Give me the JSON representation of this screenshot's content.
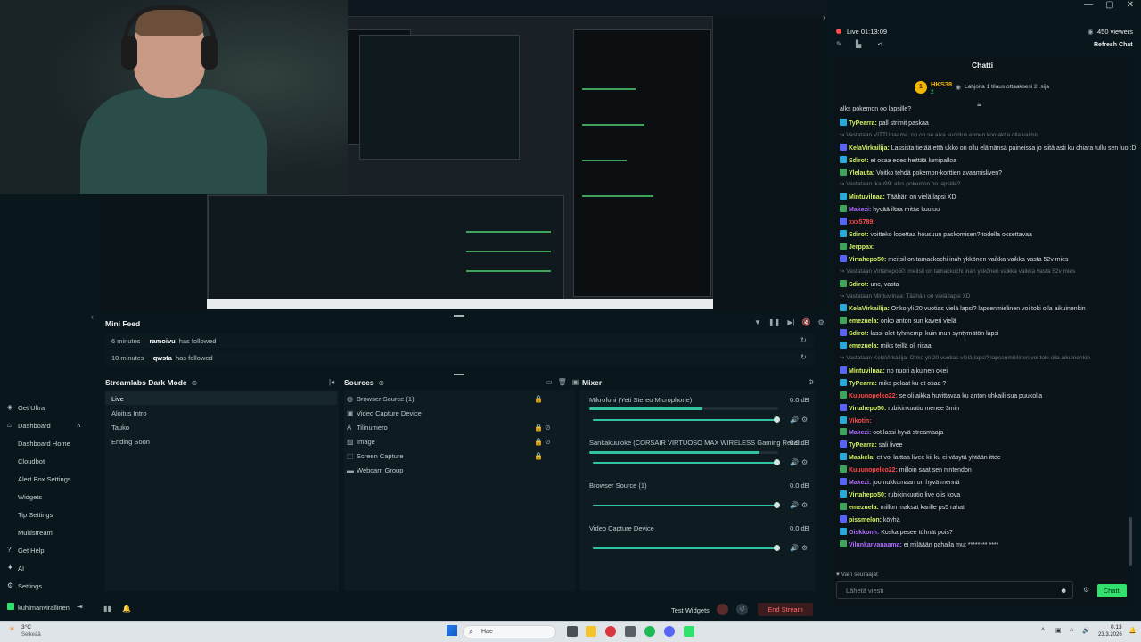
{
  "chat": {
    "live_label": "Live 01:13:09",
    "viewers": "450 viewers",
    "refresh_label": "Refresh Chat",
    "title": "Chatti",
    "sub_user": "HKS38",
    "sub_count": "2",
    "sub_text": "Lahjoita 1 tilaus ottaaksesi 2. sija",
    "messages": [
      {
        "user": "",
        "text": "alks pokemon oo lapsille?",
        "faint": false,
        "color": "#d9dfe0"
      },
      {
        "user": "TyPearra:",
        "text": "pall strimit paskaa",
        "faint": false,
        "color": "#d5f062"
      },
      {
        "user": "",
        "text": "Vastataan VITTUnaama: no on se aika suoritus ennen kontaktia olla valmis",
        "faint": true,
        "color": "#6c7a7f"
      },
      {
        "user": "KelaVirkailija:",
        "text": "Lassista tietää että ukko on ollu elämänsä paineissa jo siitä asti ku chiara tullu sen luo :D",
        "faint": false,
        "color": "#d5f062"
      },
      {
        "user": "Sdirot:",
        "text": "et osaa edes heittää lumipalloa",
        "faint": false,
        "color": "#d5f062"
      },
      {
        "user": "Ylelauta:",
        "text": "Voitko tehdä pokemon-korttien avaamisliven?",
        "faint": false,
        "color": "#d5f062"
      },
      {
        "user": "",
        "text": "Vastataan Ikau99: alks pokemon oo lapsille?",
        "faint": true,
        "color": "#6c7a7f"
      },
      {
        "user": "Mintuvilnaa:",
        "text": "Täähän on vielä lapsi XD",
        "faint": false,
        "color": "#d5f062"
      },
      {
        "user": "Makezi:",
        "text": "hyvää iltaa mitäs kuuluu",
        "faint": false,
        "color": "#b06cff"
      },
      {
        "user": "xxx5789:",
        "text": "",
        "faint": false,
        "color": "#ff4a4a"
      },
      {
        "user": "Sdirot:",
        "text": "voitteko lopettaa housuun paskomisen? todella oksettavaa",
        "faint": false,
        "color": "#d5f062"
      },
      {
        "user": "Jerppax:",
        "text": "",
        "faint": false,
        "color": "#d5f062"
      },
      {
        "user": "Virtahepo50:",
        "text": "meitsil on tamackochi inah ykkönen vaikka vaikka vasta 52v mies",
        "faint": false,
        "color": "#d5f062"
      },
      {
        "user": "",
        "text": "Vastataan Virtahepo50: meitsil on tamackochi inah ykkönen vaikka vaikka vasta 52v mies",
        "faint": true,
        "color": "#6c7a7f"
      },
      {
        "user": "Sdirot:",
        "text": "unc, vasta",
        "faint": false,
        "color": "#d5f062"
      },
      {
        "user": "",
        "text": "Vastataan Mintuvilnaa: Täähän on vielä lapsi XD",
        "faint": true,
        "color": "#6c7a7f"
      },
      {
        "user": "KelaVirkailija:",
        "text": "Onko yli 20 vuotias vielä lapsi? lapsenmielinen voi toki olla aikuinenkin",
        "faint": false,
        "color": "#d5f062"
      },
      {
        "user": "emezuela:",
        "text": "onko anton sun kaveri vielä",
        "faint": false,
        "color": "#d5f062"
      },
      {
        "user": "Sdirot:",
        "text": "lassi olet tyhmempi kuin mun syntymätön lapsi",
        "faint": false,
        "color": "#d5f062"
      },
      {
        "user": "emezuela:",
        "text": "miks teillä oli riitaa",
        "faint": false,
        "color": "#d5f062"
      },
      {
        "user": "",
        "text": "Vastataan KelaVirkailija: Onko yli 20 vuotias vielä lapsi? lapsenmielinen voi toki olla aikuinenkin",
        "faint": true,
        "color": "#6c7a7f"
      },
      {
        "user": "Mintuvilnaa:",
        "text": "no nuori aikuinen okei",
        "faint": false,
        "color": "#d5f062"
      },
      {
        "user": "TyPearra:",
        "text": "miks pelaat ku et osaa ?",
        "faint": false,
        "color": "#d5f062"
      },
      {
        "user": "Kuuunopelko22:",
        "text": "se oli aikka huvittavaa ku anton uhkaili sua puukolla",
        "faint": false,
        "color": "#ff4a4a"
      },
      {
        "user": "Virtahepo50:",
        "text": "rubikinkuutio menee 3min",
        "faint": false,
        "color": "#d5f062"
      },
      {
        "user": "Vikotin:",
        "text": "",
        "faint": false,
        "color": "#ff4a4a"
      },
      {
        "user": "Makezi:",
        "text": "oot lassi hyvä streamaaja",
        "faint": false,
        "color": "#b06cff"
      },
      {
        "user": "TyPearra:",
        "text": "sali livee",
        "faint": false,
        "color": "#d5f062"
      },
      {
        "user": "Maakela:",
        "text": "et voi laittaa livee kii ku ei väsytä yhtään ittee",
        "faint": false,
        "color": "#d5f062"
      },
      {
        "user": "Kuuunopelko22:",
        "text": "milloin saat sen nintendon",
        "faint": false,
        "color": "#ff4a4a"
      },
      {
        "user": "Makezi:",
        "text": "joo nukkumaan on hyvä mennä",
        "faint": false,
        "color": "#b06cff"
      },
      {
        "user": "Virtahepo50:",
        "text": "rubikinkuutio live olis kova",
        "faint": false,
        "color": "#d5f062"
      },
      {
        "user": "emezuela:",
        "text": "millon maksat karille ps5 rahat",
        "faint": false,
        "color": "#d5f062"
      },
      {
        "user": "pissmelon:",
        "text": "köyhä",
        "faint": false,
        "color": "#d5f062"
      },
      {
        "user": "Oiskkonn:",
        "text": "Koska pesee töhnät pois?",
        "faint": false,
        "color": "#b06cff"
      },
      {
        "user": "Vilunkarvanaama:",
        "text": "ei miläään pahalla mut ******** ****",
        "faint": false,
        "color": "#b06cff"
      }
    ],
    "followers_only": "Vain seuraajat",
    "input_placeholder": "Lähetä viesti",
    "send_label": "Chatti"
  },
  "minifeed": {
    "title": "Mini Feed",
    "events": [
      {
        "time": "6 minutes",
        "user": "ramoivu",
        "action": "has followed"
      },
      {
        "time": "10 minutes",
        "user": "qwsta",
        "action": "has followed"
      }
    ]
  },
  "scenes": {
    "title": "Streamlabs Dark Mode",
    "items": [
      "Live",
      "Aloitus Intro",
      "Tauko",
      "Ending Soon"
    ]
  },
  "sources": {
    "title": "Sources",
    "items": [
      "Browser Source (1)",
      "Video Capture Device",
      "Tilinumero",
      "Image",
      "Screen Capture",
      "Webcam Group"
    ]
  },
  "mixer": {
    "title": "Mixer",
    "channels": [
      {
        "name": "Mikrofoni (Yeti Stereo Microphone)",
        "db": "0.0 dB",
        "level": 0.6,
        "volume": 0.98
      },
      {
        "name": "Sankakuuloke (CORSAIR VIRTUOSO MAX WIRELESS Gaming Recei...",
        "db": "0.0 dB",
        "level": 0.9,
        "volume": 0.98
      },
      {
        "name": "Browser Source (1)",
        "db": "0.0 dB",
        "level": 0,
        "volume": 0.98
      },
      {
        "name": "Video Capture Device",
        "db": "0.0 dB",
        "level": 0,
        "volume": 0.98
      }
    ]
  },
  "sidebar": {
    "items": [
      {
        "label": "Get Ultra",
        "sub": false
      },
      {
        "label": "Dashboard",
        "sub": false
      },
      {
        "label": "Dashboard Home",
        "sub": true
      },
      {
        "label": "Cloudbot",
        "sub": true
      },
      {
        "label": "Alert Box Settings",
        "sub": true
      },
      {
        "label": "Widgets",
        "sub": true
      },
      {
        "label": "Tip Settings",
        "sub": true
      },
      {
        "label": "Multistream",
        "sub": true
      },
      {
        "label": "Get Help",
        "sub": false
      },
      {
        "label": "AI",
        "sub": false
      },
      {
        "label": "Settings",
        "sub": false
      }
    ],
    "account": "kuhlmanvirallinen"
  },
  "footer": {
    "test_widgets": "Test Widgets",
    "end_stream": "End Stream"
  },
  "taskbar": {
    "weather_temp": "3°C",
    "weather_desc": "Selkeää",
    "search_placeholder": "Hae",
    "time": "0.13",
    "date": "23.3.2026"
  },
  "colors": {
    "accent": "#31e06d",
    "background": "#09161c",
    "end_stream": "#ff6a6a"
  }
}
